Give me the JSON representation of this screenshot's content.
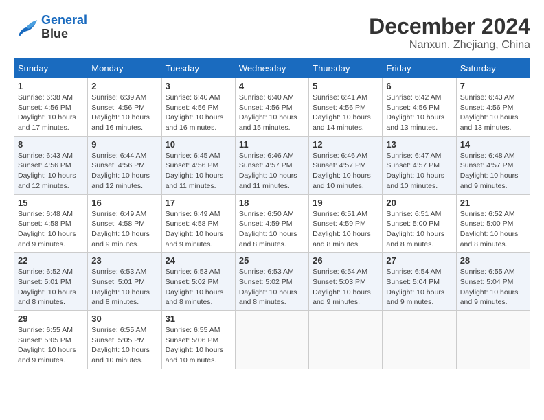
{
  "header": {
    "logo_line1": "General",
    "logo_line2": "Blue",
    "month": "December 2024",
    "location": "Nanxun, Zhejiang, China"
  },
  "weekdays": [
    "Sunday",
    "Monday",
    "Tuesday",
    "Wednesday",
    "Thursday",
    "Friday",
    "Saturday"
  ],
  "weeks": [
    [
      {
        "day": "1",
        "info": "Sunrise: 6:38 AM\nSunset: 4:56 PM\nDaylight: 10 hours\nand 17 minutes."
      },
      {
        "day": "2",
        "info": "Sunrise: 6:39 AM\nSunset: 4:56 PM\nDaylight: 10 hours\nand 16 minutes."
      },
      {
        "day": "3",
        "info": "Sunrise: 6:40 AM\nSunset: 4:56 PM\nDaylight: 10 hours\nand 16 minutes."
      },
      {
        "day": "4",
        "info": "Sunrise: 6:40 AM\nSunset: 4:56 PM\nDaylight: 10 hours\nand 15 minutes."
      },
      {
        "day": "5",
        "info": "Sunrise: 6:41 AM\nSunset: 4:56 PM\nDaylight: 10 hours\nand 14 minutes."
      },
      {
        "day": "6",
        "info": "Sunrise: 6:42 AM\nSunset: 4:56 PM\nDaylight: 10 hours\nand 13 minutes."
      },
      {
        "day": "7",
        "info": "Sunrise: 6:43 AM\nSunset: 4:56 PM\nDaylight: 10 hours\nand 13 minutes."
      }
    ],
    [
      {
        "day": "8",
        "info": "Sunrise: 6:43 AM\nSunset: 4:56 PM\nDaylight: 10 hours\nand 12 minutes."
      },
      {
        "day": "9",
        "info": "Sunrise: 6:44 AM\nSunset: 4:56 PM\nDaylight: 10 hours\nand 12 minutes."
      },
      {
        "day": "10",
        "info": "Sunrise: 6:45 AM\nSunset: 4:56 PM\nDaylight: 10 hours\nand 11 minutes."
      },
      {
        "day": "11",
        "info": "Sunrise: 6:46 AM\nSunset: 4:57 PM\nDaylight: 10 hours\nand 11 minutes."
      },
      {
        "day": "12",
        "info": "Sunrise: 6:46 AM\nSunset: 4:57 PM\nDaylight: 10 hours\nand 10 minutes."
      },
      {
        "day": "13",
        "info": "Sunrise: 6:47 AM\nSunset: 4:57 PM\nDaylight: 10 hours\nand 10 minutes."
      },
      {
        "day": "14",
        "info": "Sunrise: 6:48 AM\nSunset: 4:57 PM\nDaylight: 10 hours\nand 9 minutes."
      }
    ],
    [
      {
        "day": "15",
        "info": "Sunrise: 6:48 AM\nSunset: 4:58 PM\nDaylight: 10 hours\nand 9 minutes."
      },
      {
        "day": "16",
        "info": "Sunrise: 6:49 AM\nSunset: 4:58 PM\nDaylight: 10 hours\nand 9 minutes."
      },
      {
        "day": "17",
        "info": "Sunrise: 6:49 AM\nSunset: 4:58 PM\nDaylight: 10 hours\nand 9 minutes."
      },
      {
        "day": "18",
        "info": "Sunrise: 6:50 AM\nSunset: 4:59 PM\nDaylight: 10 hours\nand 8 minutes."
      },
      {
        "day": "19",
        "info": "Sunrise: 6:51 AM\nSunset: 4:59 PM\nDaylight: 10 hours\nand 8 minutes."
      },
      {
        "day": "20",
        "info": "Sunrise: 6:51 AM\nSunset: 5:00 PM\nDaylight: 10 hours\nand 8 minutes."
      },
      {
        "day": "21",
        "info": "Sunrise: 6:52 AM\nSunset: 5:00 PM\nDaylight: 10 hours\nand 8 minutes."
      }
    ],
    [
      {
        "day": "22",
        "info": "Sunrise: 6:52 AM\nSunset: 5:01 PM\nDaylight: 10 hours\nand 8 minutes."
      },
      {
        "day": "23",
        "info": "Sunrise: 6:53 AM\nSunset: 5:01 PM\nDaylight: 10 hours\nand 8 minutes."
      },
      {
        "day": "24",
        "info": "Sunrise: 6:53 AM\nSunset: 5:02 PM\nDaylight: 10 hours\nand 8 minutes."
      },
      {
        "day": "25",
        "info": "Sunrise: 6:53 AM\nSunset: 5:02 PM\nDaylight: 10 hours\nand 8 minutes."
      },
      {
        "day": "26",
        "info": "Sunrise: 6:54 AM\nSunset: 5:03 PM\nDaylight: 10 hours\nand 9 minutes."
      },
      {
        "day": "27",
        "info": "Sunrise: 6:54 AM\nSunset: 5:04 PM\nDaylight: 10 hours\nand 9 minutes."
      },
      {
        "day": "28",
        "info": "Sunrise: 6:55 AM\nSunset: 5:04 PM\nDaylight: 10 hours\nand 9 minutes."
      }
    ],
    [
      {
        "day": "29",
        "info": "Sunrise: 6:55 AM\nSunset: 5:05 PM\nDaylight: 10 hours\nand 9 minutes."
      },
      {
        "day": "30",
        "info": "Sunrise: 6:55 AM\nSunset: 5:05 PM\nDaylight: 10 hours\nand 10 minutes."
      },
      {
        "day": "31",
        "info": "Sunrise: 6:55 AM\nSunset: 5:06 PM\nDaylight: 10 hours\nand 10 minutes."
      },
      {
        "day": "",
        "info": ""
      },
      {
        "day": "",
        "info": ""
      },
      {
        "day": "",
        "info": ""
      },
      {
        "day": "",
        "info": ""
      }
    ]
  ]
}
